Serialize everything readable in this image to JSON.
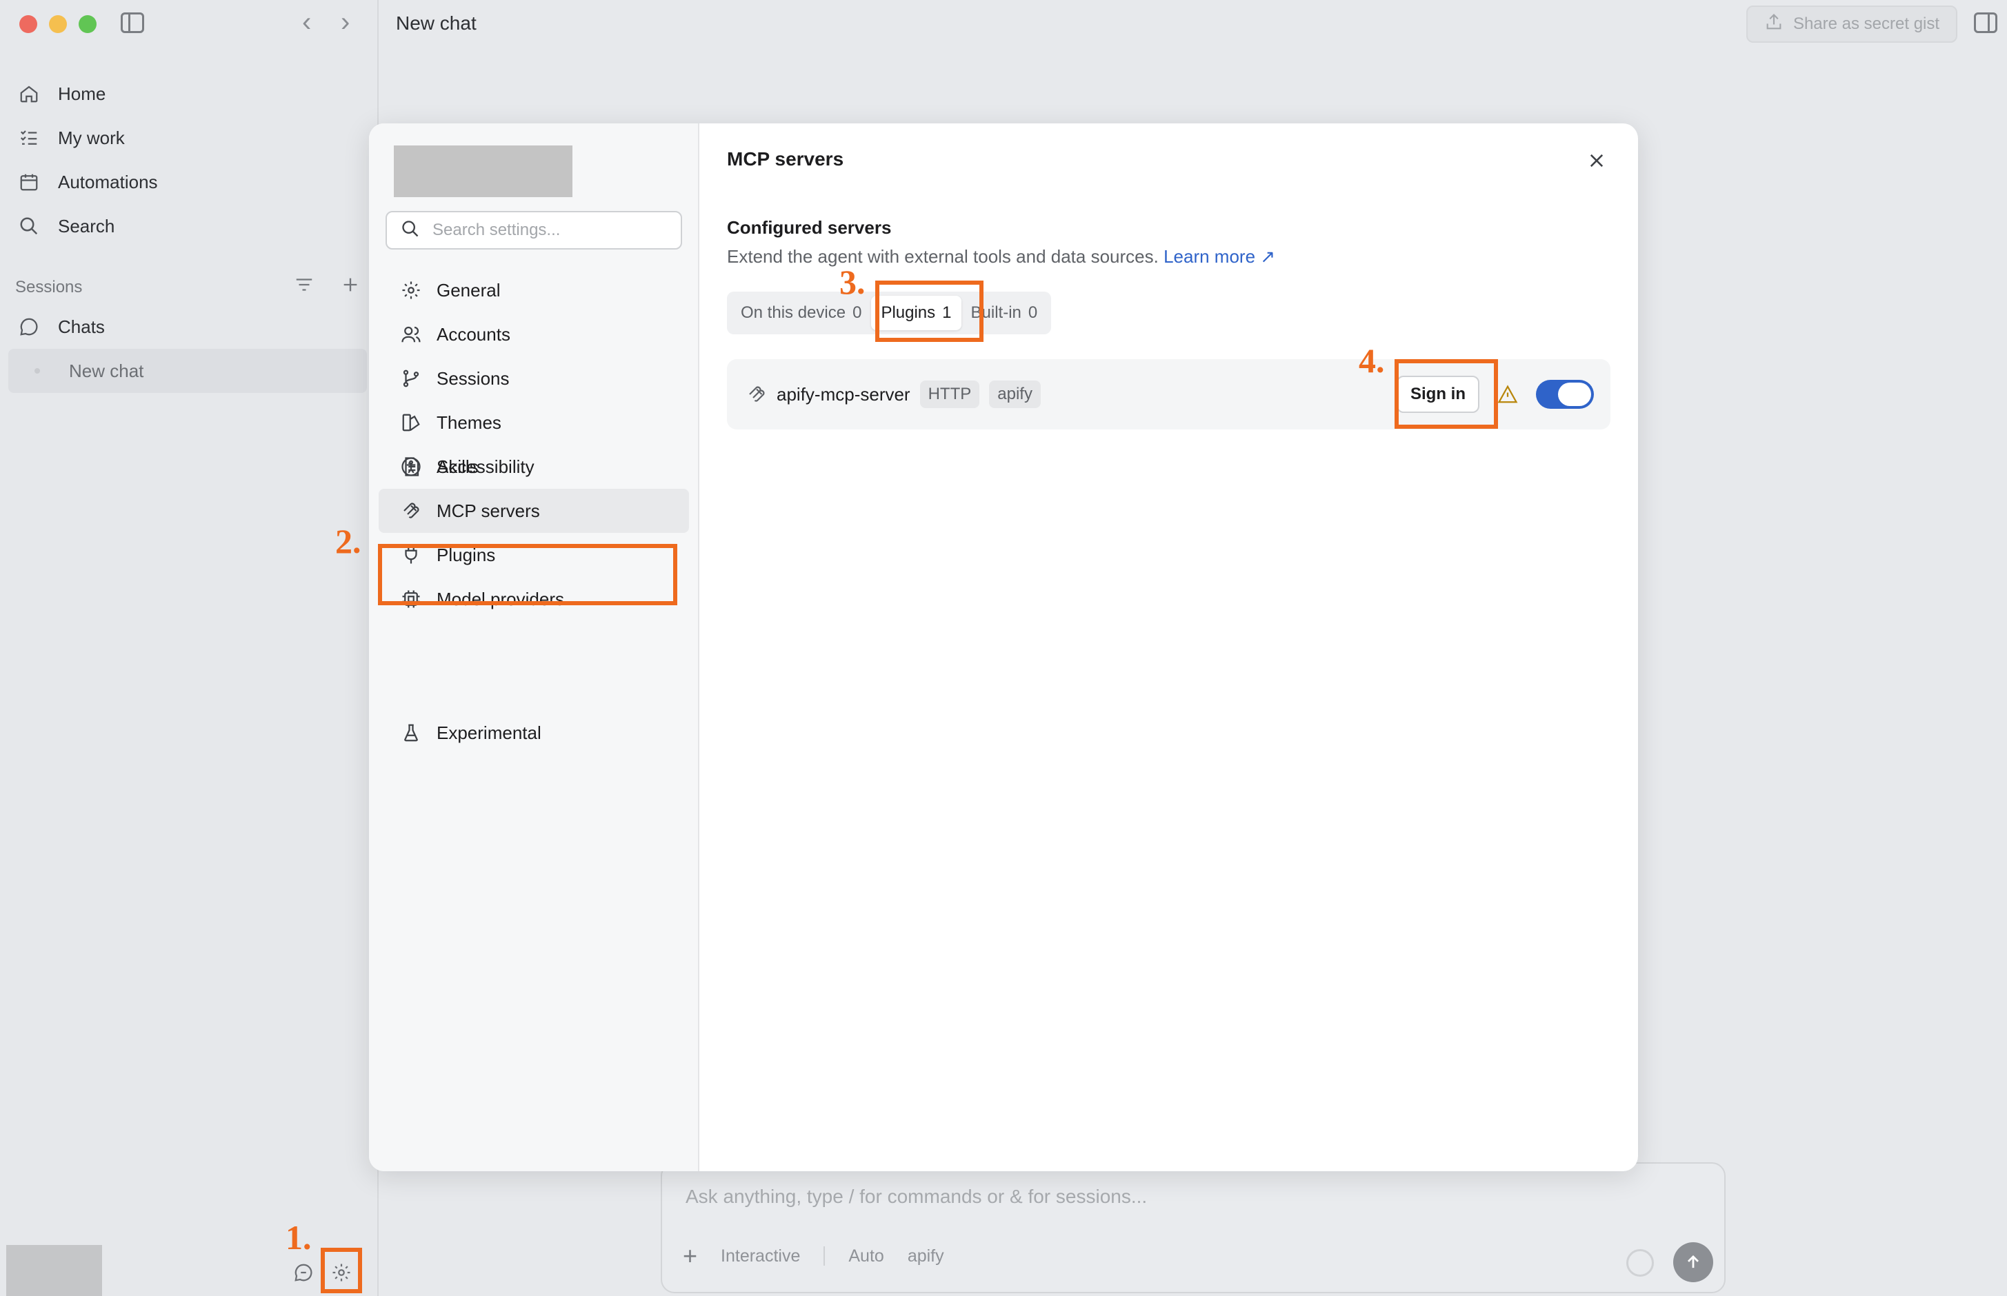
{
  "window": {
    "title": "New chat"
  },
  "sidebar": {
    "nav": [
      {
        "label": "Home",
        "icon": "home-icon"
      },
      {
        "label": "My work",
        "icon": "checklist-icon"
      },
      {
        "label": "Automations",
        "icon": "calendar-icon"
      },
      {
        "label": "Search",
        "icon": "search-icon"
      }
    ],
    "sessions_label": "Sessions",
    "chats_label": "Chats",
    "active_chat": "New chat"
  },
  "header": {
    "share_label": "Share as secret gist"
  },
  "composer": {
    "placeholder": "Ask anything, type / for commands or & for sessions...",
    "mode": "Interactive",
    "model": "Auto",
    "context": "apify"
  },
  "settings": {
    "search_placeholder": "Search settings...",
    "nav": [
      {
        "label": "General",
        "icon": "gear-icon"
      },
      {
        "label": "Accounts",
        "icon": "users-icon"
      },
      {
        "label": "Sessions",
        "icon": "branch-icon"
      },
      {
        "label": "Themes",
        "icon": "palette-icon"
      },
      {
        "label": "Accessibility",
        "icon": "accessibility-icon"
      },
      {
        "label": "Skills",
        "icon": "document-icon"
      },
      {
        "label": "MCP servers",
        "icon": "mcp-icon"
      },
      {
        "label": "Plugins",
        "icon": "plug-icon"
      },
      {
        "label": "Model providers",
        "icon": "chip-icon"
      },
      {
        "label": "Experimental",
        "icon": "flask-icon"
      }
    ],
    "active": "MCP servers",
    "panel": {
      "title": "MCP servers",
      "section_title": "Configured servers",
      "description": "Extend the agent with external tools and data sources.",
      "learn_more": "Learn more ↗",
      "tabs": [
        {
          "label": "On this device",
          "count": "0"
        },
        {
          "label": "Plugins",
          "count": "1"
        },
        {
          "label": "Built-in",
          "count": "0"
        }
      ],
      "active_tab": "Plugins",
      "servers": [
        {
          "name": "apify-mcp-server",
          "transport": "HTTP",
          "source": "apify",
          "action": "Sign in",
          "enabled": true
        }
      ]
    }
  },
  "annotations": {
    "step1": "1.",
    "step2": "2.",
    "step3": "3.",
    "step4": "4.",
    "color": "#ee6a1e"
  },
  "colors": {
    "accent": "#2f63c9",
    "highlight": "#ee6a1e"
  }
}
